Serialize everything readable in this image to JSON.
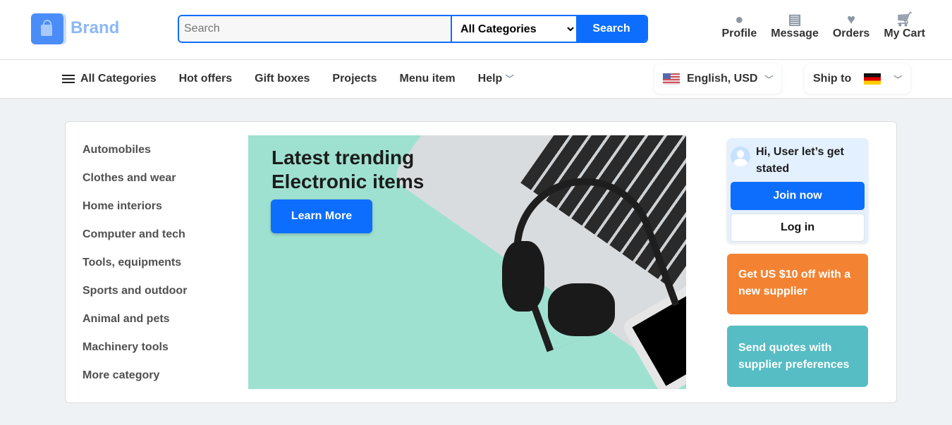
{
  "header": {
    "brand": "Brand",
    "search_placeholder": "Search",
    "category_select": "All Categories",
    "search_button": "Search",
    "actions": [
      {
        "label": "Profile",
        "icon": "person-icon"
      },
      {
        "label": "Message",
        "icon": "message-icon"
      },
      {
        "label": "Orders",
        "icon": "heart-icon"
      },
      {
        "label": "My Cart",
        "icon": "cart-icon"
      }
    ]
  },
  "nav": {
    "items": [
      "All Categories",
      "Hot offers",
      "Gift boxes",
      "Projects",
      "Menu item",
      "Help"
    ],
    "language": "English, USD",
    "ship_to": "Ship to"
  },
  "categories": [
    "Automobiles",
    "Clothes and wear",
    "Home interiors",
    "Computer and tech",
    "Tools, equipments",
    "Sports and outdoor",
    "Animal and pets",
    "Machinery tools",
    "More category"
  ],
  "banner": {
    "title": "Latest trending Electronic items",
    "button": "Learn More"
  },
  "user_card": {
    "greeting": "Hi, User let’s get stated",
    "join": "Join now",
    "login": "Log in"
  },
  "promos": [
    "Get US $10 off with a new supplier",
    "Send quotes with supplier preferences"
  ],
  "colors": {
    "primary": "#0d6efd",
    "orange": "#f38332",
    "teal": "#55bdc3"
  }
}
